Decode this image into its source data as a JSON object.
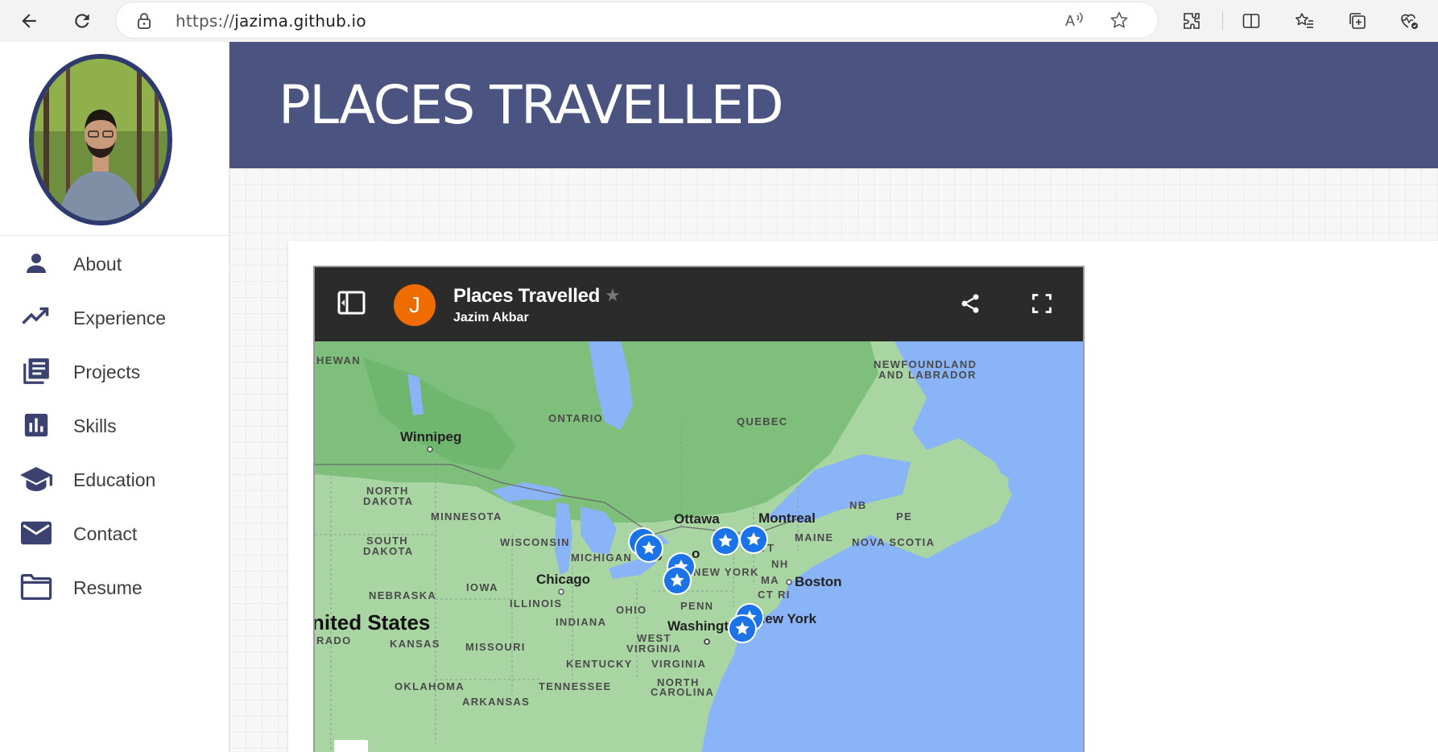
{
  "browser": {
    "url_prefix": "https://",
    "url_host": "jazima.github.io"
  },
  "sidebar": {
    "items": [
      {
        "label": "About",
        "icon": "person-icon"
      },
      {
        "label": "Experience",
        "icon": "trending-up-icon"
      },
      {
        "label": "Projects",
        "icon": "library-books-icon"
      },
      {
        "label": "Skills",
        "icon": "bar-chart-icon"
      },
      {
        "label": "Education",
        "icon": "graduation-cap-icon"
      },
      {
        "label": "Contact",
        "icon": "mail-icon"
      },
      {
        "label": "Resume",
        "icon": "folder-icon"
      }
    ]
  },
  "banner": {
    "title": "PLACES TRAVELLED"
  },
  "map_embed": {
    "title": "Places Travelled",
    "author": "Jazim Akbar",
    "owner_initial": "J",
    "labels": {
      "regions": [
        "HEWAN",
        "ONTARIO",
        "QUEBEC",
        "NEWFOUNDLAND",
        "AND LABRADOR",
        "NORTH",
        "DAKOTA",
        "SOUTH",
        "DAKOTA",
        "MINNESOTA",
        "WISCONSIN",
        "MICHIGAN",
        "IOWA",
        "NEBRASKA",
        "ILLINOIS",
        "INDIANA",
        "OHIO",
        "PENN",
        "NEW YORK",
        "VT",
        "NH",
        "MA",
        "CT",
        "RI",
        "MAINE",
        "NB",
        "PE",
        "NOVA SCOTIA",
        "KANSAS",
        "MISSOURI",
        "WEST",
        "VIRGINIA",
        "VIRGINIA",
        "KENTUCKY",
        "TENNESSEE",
        "NORTH",
        "CAROLINA",
        "OKLAHOMA",
        "ARKANSAS",
        "RADO"
      ],
      "cities": [
        "Winnipeg",
        "Ottawa",
        "Montreal",
        "Chicago",
        "Boston",
        "Washingt",
        "New York",
        "To",
        "o"
      ],
      "country": "nited States"
    }
  },
  "colors": {
    "banner": "#4b5480",
    "avatar_ring": "#2f3b6e",
    "map_header": "#2b2b2b",
    "owner_avatar": "#ef6c00",
    "marker": "#1a73e8",
    "water": "#8ab4f8",
    "land": "#a8d5a2"
  }
}
